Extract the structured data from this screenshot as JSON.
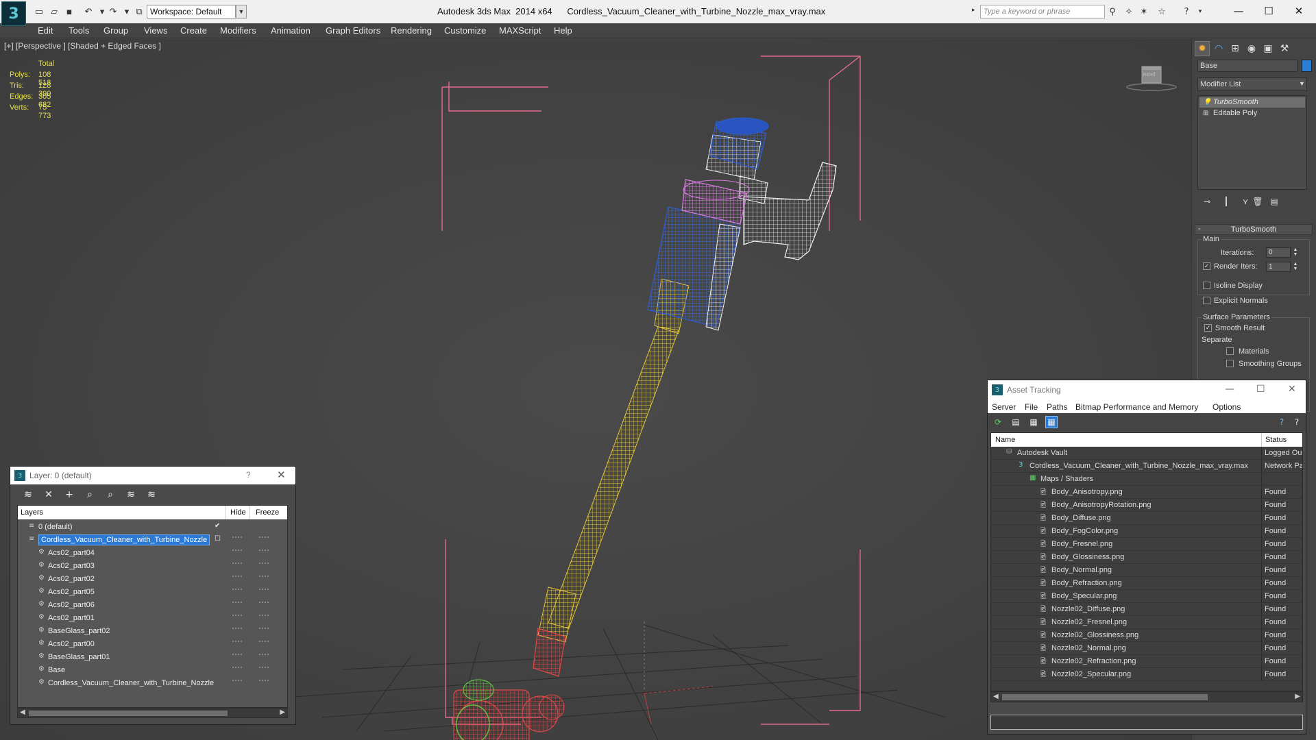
{
  "app": {
    "title": "Autodesk 3ds Max  2014 x64      Cordless_Vacuum_Cleaner_with_Turbine_Nozzle_max_vray.max",
    "workspace": "Workspace: Default",
    "search_placeholder": "Type a keyword or phrase"
  },
  "menu": [
    "Edit",
    "Tools",
    "Group",
    "Views",
    "Create",
    "Modifiers",
    "Animation",
    "Graph Editors",
    "Rendering",
    "Customize",
    "MAXScript",
    "Help"
  ],
  "viewport": {
    "label": "[+] [Perspective ] [Shaded + Edged Faces ]",
    "viewcube_label": "RIGHT",
    "stats": {
      "header": "Total",
      "rows": [
        {
          "k": "Polys:",
          "v": "108 518"
        },
        {
          "k": "Tris:",
          "v": "128 390"
        },
        {
          "k": "Edges:",
          "v": "305 682"
        },
        {
          "k": "Verts:",
          "v": "75 773"
        }
      ]
    }
  },
  "command_panel": {
    "object_name": "Base",
    "modifier_list": "Modifier List",
    "stack": [
      "TurboSmooth",
      "Editable Poly"
    ],
    "rollout": "TurboSmooth",
    "main_group": "Main",
    "iterations_label": "Iterations:",
    "iterations_value": "0",
    "render_iters_label": "Render Iters:",
    "render_iters_value": "1",
    "isoline_label": "Isoline Display",
    "explicit_normals_label": "Explicit Normals",
    "surface_params_label": "Surface Parameters",
    "smooth_result_label": "Smooth Result",
    "separate_label": "Separate",
    "materials_label": "Materials",
    "smoothing_groups_label": "Smoothing Groups"
  },
  "layer_dialog": {
    "title": "Layer: 0 (default)",
    "help": "?",
    "columns": {
      "layers": "Layers",
      "hide": "Hide",
      "freeze": "Freeze"
    },
    "rows": [
      {
        "name": "0 (default)",
        "indent": 1,
        "selected": false,
        "check": true
      },
      {
        "name": "Cordless_Vacuum_Cleaner_with_Turbine_Nozzle",
        "indent": 1,
        "selected": true,
        "check": false
      },
      {
        "name": "Acs02_part04",
        "indent": 2,
        "selected": false,
        "check": false
      },
      {
        "name": "Acs02_part03",
        "indent": 2,
        "selected": false,
        "check": false
      },
      {
        "name": "Acs02_part02",
        "indent": 2,
        "selected": false,
        "check": false
      },
      {
        "name": "Acs02_part05",
        "indent": 2,
        "selected": false,
        "check": false
      },
      {
        "name": "Acs02_part06",
        "indent": 2,
        "selected": false,
        "check": false
      },
      {
        "name": "Acs02_part01",
        "indent": 2,
        "selected": false,
        "check": false
      },
      {
        "name": "BaseGlass_part02",
        "indent": 2,
        "selected": false,
        "check": false
      },
      {
        "name": "Acs02_part00",
        "indent": 2,
        "selected": false,
        "check": false
      },
      {
        "name": "BaseGlass_part01",
        "indent": 2,
        "selected": false,
        "check": false
      },
      {
        "name": "Base",
        "indent": 2,
        "selected": false,
        "check": false
      },
      {
        "name": "Cordless_Vacuum_Cleaner_with_Turbine_Nozzle",
        "indent": 2,
        "selected": false,
        "check": false
      }
    ]
  },
  "asset_dialog": {
    "title": "Asset Tracking",
    "menu": [
      "Server",
      "File",
      "Paths",
      "Bitmap Performance and Memory",
      "Options"
    ],
    "columns": {
      "name": "Name",
      "status": "Status"
    },
    "rows": [
      {
        "name": "Autodesk Vault",
        "status": "Logged Ou",
        "level": 1
      },
      {
        "name": "Cordless_Vacuum_Cleaner_with_Turbine_Nozzle_max_vray.max",
        "status": "Network Pa",
        "level": 2
      },
      {
        "name": "Maps / Shaders",
        "status": "",
        "level": 3
      },
      {
        "name": "Body_Anisotropy.png",
        "status": "Found",
        "level": 4
      },
      {
        "name": "Body_AnisotropyRotation.png",
        "status": "Found",
        "level": 4
      },
      {
        "name": "Body_Diffuse.png",
        "status": "Found",
        "level": 4
      },
      {
        "name": "Body_FogColor.png",
        "status": "Found",
        "level": 4
      },
      {
        "name": "Body_Fresnel.png",
        "status": "Found",
        "level": 4
      },
      {
        "name": "Body_Glossiness.png",
        "status": "Found",
        "level": 4
      },
      {
        "name": "Body_Normal.png",
        "status": "Found",
        "level": 4
      },
      {
        "name": "Body_Refraction.png",
        "status": "Found",
        "level": 4
      },
      {
        "name": "Body_Specular.png",
        "status": "Found",
        "level": 4
      },
      {
        "name": "Nozzle02_Diffuse.png",
        "status": "Found",
        "level": 4
      },
      {
        "name": "Nozzle02_Fresnel.png",
        "status": "Found",
        "level": 4
      },
      {
        "name": "Nozzle02_Glossiness.png",
        "status": "Found",
        "level": 4
      },
      {
        "name": "Nozzle02_Normal.png",
        "status": "Found",
        "level": 4
      },
      {
        "name": "Nozzle02_Refraction.png",
        "status": "Found",
        "level": 4
      },
      {
        "name": "Nozzle02_Specular.png",
        "status": "Found",
        "level": 4
      }
    ]
  },
  "colors": {
    "viewport_bg": "#444444",
    "stats_text": "#e8e24a",
    "selection_blue": "#2b7bd6",
    "wire_yellow": "#e2c43a",
    "wire_blue": "#1f4fb8",
    "wire_pink": "#d87be0",
    "wire_red": "#e04848",
    "wire_white": "#f0f0f0",
    "wire_green": "#60c040",
    "bbox_pink": "#e46a8a"
  }
}
